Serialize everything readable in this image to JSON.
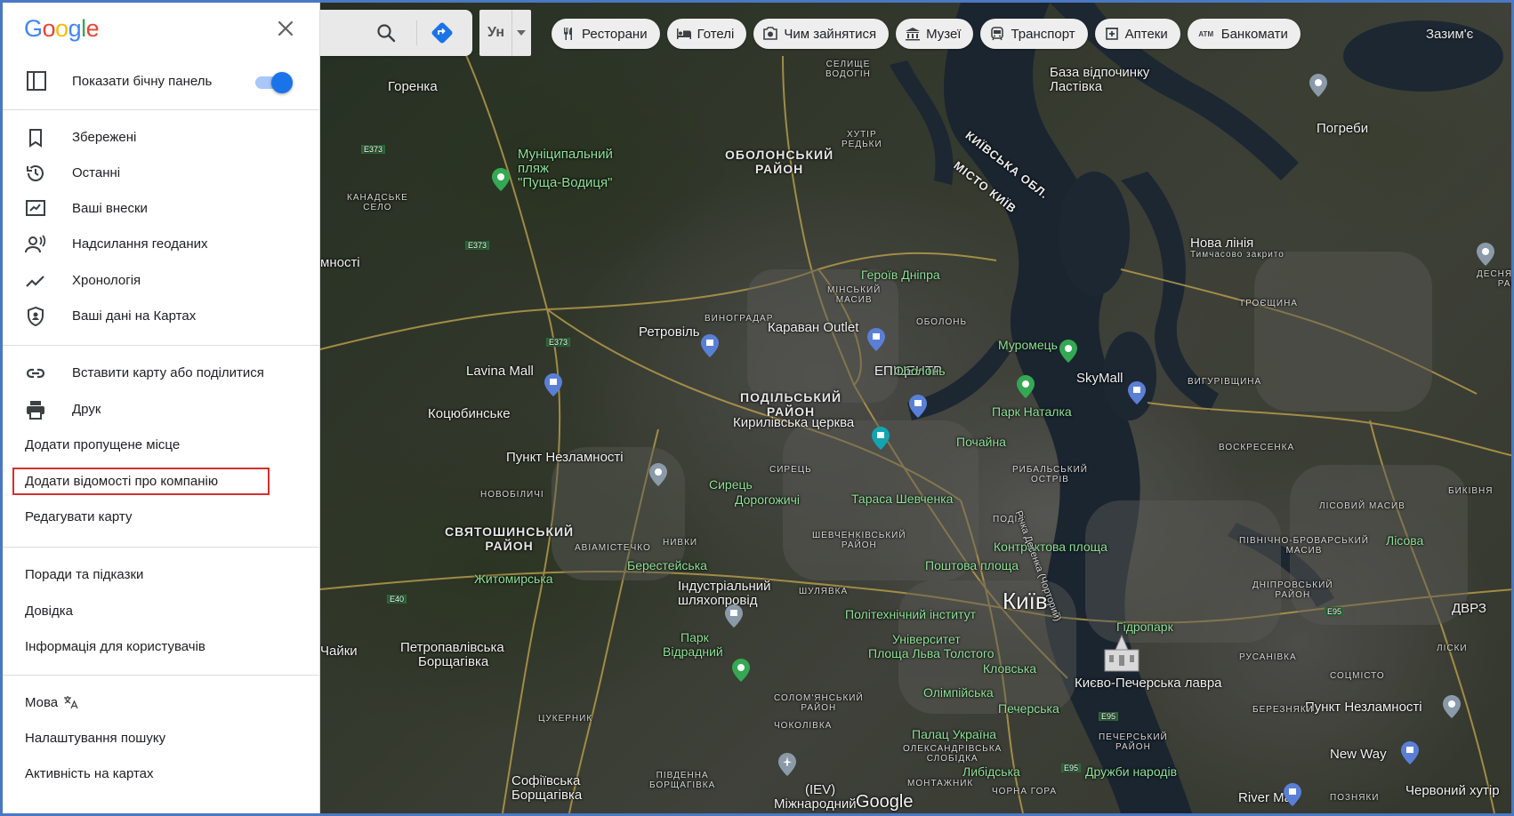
{
  "topbar": {
    "layer_label": "Ун",
    "chips": [
      {
        "icon": "restaurant-icon",
        "label": "Ресторани"
      },
      {
        "icon": "hotel-icon",
        "label": "Готелі"
      },
      {
        "icon": "camera-icon",
        "label": "Чим зайнятися"
      },
      {
        "icon": "museum-icon",
        "label": "Музеї"
      },
      {
        "icon": "transit-icon",
        "label": "Транспорт"
      },
      {
        "icon": "pharmacy-icon",
        "label": "Аптеки"
      },
      {
        "icon": "atm-icon",
        "label": "Банкомати",
        "badge": "ATM"
      }
    ],
    "right_text": "Зазим'є"
  },
  "sidebar": {
    "logo": "Google",
    "show_panel": {
      "label": "Показати бічну панель",
      "enabled": true
    },
    "section1": [
      {
        "icon": "bookmark-icon",
        "label": "Збережені"
      },
      {
        "icon": "history-icon",
        "label": "Останні"
      },
      {
        "icon": "contributions-icon",
        "label": "Ваші внески"
      },
      {
        "icon": "location-sharing-icon",
        "label": "Надсилання геоданих"
      },
      {
        "icon": "timeline-icon",
        "label": "Хронологія"
      },
      {
        "icon": "shield-icon",
        "label": "Ваші дані на Картах"
      }
    ],
    "section2": [
      {
        "icon": "link-icon",
        "label": "Вставити карту або поділитися"
      },
      {
        "icon": "print-icon",
        "label": "Друк"
      },
      {
        "label": "Додати пропущене місце"
      },
      {
        "label": "Додати відомості про компанію"
      },
      {
        "label": "Редагувати карту"
      }
    ],
    "section3": [
      {
        "label": "Поради та підказки"
      },
      {
        "label": "Довідка"
      },
      {
        "label": "Інформація для користувачів"
      }
    ],
    "section4": [
      {
        "label": "Мова"
      },
      {
        "label": "Налаштування пошуку"
      },
      {
        "label": "Активність на картах"
      }
    ]
  },
  "map": {
    "attribution": "Google",
    "city": "Київ",
    "districts": [
      "ОБОЛОНСЬКИЙ\nРАЙОН",
      "ПОДІЛЬСЬКИЙ\nРАЙОН",
      "СВЯТОШИНСЬКИЙ\nРАЙОН"
    ],
    "region_label_1": "КИЇВСЬКА ОБЛ.",
    "region_label_2": "МІСТО КИЇВ",
    "places": [
      "Горенка",
      "Муніципальний",
      "пляж",
      "\"Пуща-Водиця\"",
      "База відпочинку",
      "Ластівка",
      "Погреби",
      "Нова лінія",
      "Тимчасово закрито",
      "Ретровіль",
      "Караван Outlet",
      "Lavina Mall",
      "Коцюбинське",
      "Кирилівська церква",
      "Пункт Незламності",
      "SkyMall",
      "ЕПІЦЕНТР",
      "Індустріальний",
      "шляхопровід",
      "Парк",
      "Відрадний",
      "Петропавлівська",
      "Борщагівка",
      "Софіївська",
      "Борщагівка",
      "Київ",
      "Києво-Печерська лавра",
      "Пункт Незламності",
      "New Way",
      "River Mall",
      "Червоний хутір",
      "ДВРЗ",
      "мності",
      "Чайки",
      "(IEV)",
      "Міжнародний"
    ],
    "metro": [
      "Героїв Дніпра",
      "Оболонь",
      "Почайна",
      "Тараса Шевченка",
      "Сирець",
      "Дорогожичі",
      "Берестейська",
      "Житомирська",
      "Поштова площа",
      "Контрактова площа",
      "Політехнічний інститут",
      "Університет",
      "Площа Льва Толстого",
      "Кловська",
      "Олімпійська",
      "Печерська",
      "Палац Україна",
      "Либідська",
      "Дружби народів",
      "Гідропарк",
      "Лісова"
    ],
    "green": [
      "Муромець",
      "Парк Наталка"
    ],
    "small_labels": [
      "СЕЛИЩЕ\nВОДОГІН",
      "ХУТІР\nРЕДЬКИ",
      "КАНАДСЬКЕ\nСЕЛО",
      "ВИНОГРАДАР",
      "МІНСЬКИЙ\nМАСИВ",
      "ОБОЛОНЬ",
      "ТРОЄЩИНА",
      "ВИГУРІВЩИНА",
      "ВОСКРЕСЕНКА",
      "РИБАЛЬСЬКИЙ\nОСТРІВ",
      "СИРЕЦЬ",
      "НОВОБІЛИЧІ",
      "НИВКИ",
      "АВІАМІСТЕЧКО",
      "ШЕВЧЕНКІВСЬКИЙ\nРАЙОН",
      "ПОДІЛ",
      "ШУЛЯВКА",
      "ЛІСОВИЙ МАСИВ",
      "БИКІВНЯ",
      "ДЕСНЯНСЬКИЙ\nРАЙОН",
      "ПІВНІЧНО-БРОВАРСЬКИЙ\nМАСИВ",
      "ДНІПРОВСЬКИЙ\nРАЙОН",
      "РУСАНІВКА",
      "СОЦМІСТО",
      "ЛІСКИ",
      "БЕРЕЗНЯКИ",
      "ЦУКЕРНИК",
      "СОЛОМ'ЯНСЬКИЙ\nРАЙОН",
      "ЧОКОЛІВКА",
      "ПЕЧЕРСЬКИЙ\nРАЙОН",
      "ОЛЕКСАНДРІВСЬКА\nСЛОБІДКА",
      "МОНТАЖНИК",
      "ЧОРНА ГОРА",
      "ПОЗНЯКИ",
      "ПІВДЕННА\nБОРЩАГІВКА"
    ],
    "roads": [
      "E373",
      "E373",
      "E373",
      "E40",
      "E95",
      "E95",
      "E95"
    ],
    "river_label": "Річка Десенка (Чорторий)"
  }
}
